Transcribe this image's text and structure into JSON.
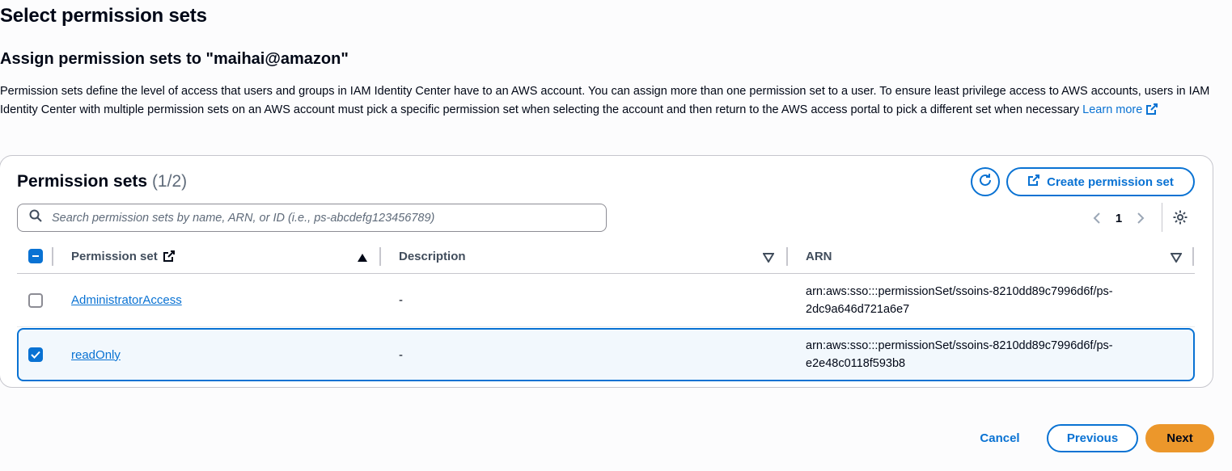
{
  "page": {
    "title": "Select permission sets",
    "section_title": "Assign permission sets to \"maihai@amazon\"",
    "description": "Permission sets define the level of access that users and groups in IAM Identity Center have to an AWS account. You can assign more than one permission set to a user. To ensure least privilege access to AWS accounts, users in IAM Identity Center with multiple permission sets on an AWS account must pick a specific permission set when selecting the account and then return to the AWS access portal to pick a different set when necessary",
    "learn_more": "Learn more"
  },
  "panel": {
    "title": "Permission sets",
    "count": "(1/2)",
    "create_label": "Create permission set",
    "search_placeholder": "Search permission sets by name, ARN, or ID (i.e., ps-abcdefg123456789)",
    "current_page": "1"
  },
  "table": {
    "columns": [
      "Permission set",
      "Description",
      "ARN"
    ],
    "rows": [
      {
        "name": "AdministratorAccess",
        "description": "-",
        "arn": "arn:aws:sso:::permissionSet/ssoins-8210dd89c7996d6f/ps-2dc9a646d721a6e7",
        "selected": false
      },
      {
        "name": "readOnly",
        "description": "-",
        "arn": "arn:aws:sso:::permissionSet/ssoins-8210dd89c7996d6f/ps-e2e48c0118f593b8",
        "selected": true
      }
    ]
  },
  "footer": {
    "cancel": "Cancel",
    "previous": "Previous",
    "next": "Next"
  },
  "colors": {
    "link": "#0972d3",
    "primary_button": "#ec972b",
    "selected_row_bg": "#f2f8fd"
  }
}
